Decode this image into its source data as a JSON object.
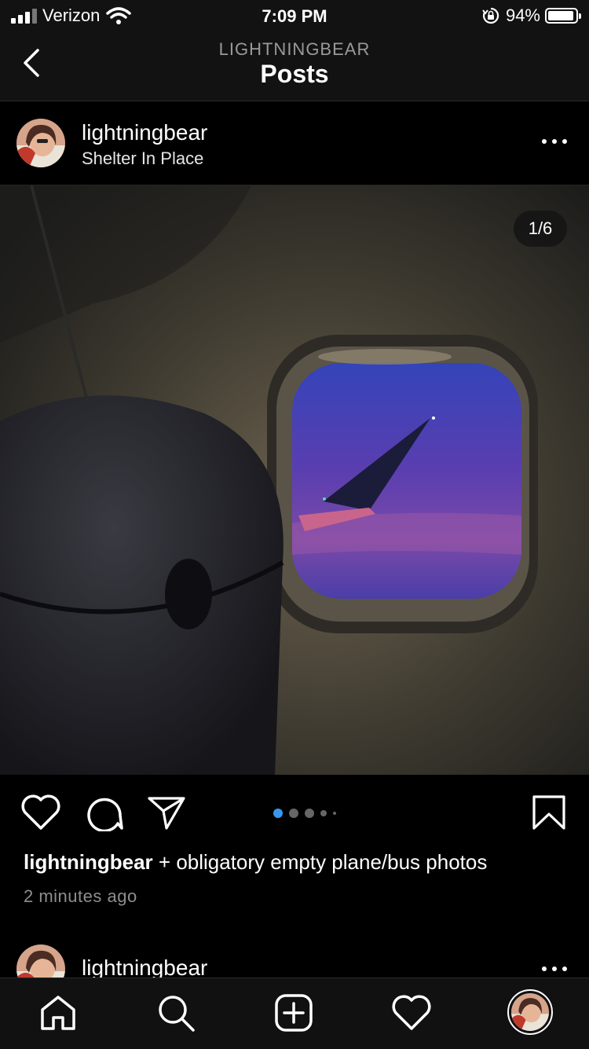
{
  "status_bar": {
    "carrier": "Verizon",
    "time": "7:09 PM",
    "battery_percent": "94%",
    "battery_level": 0.94,
    "icons": [
      "signal-icon",
      "wifi-icon",
      "orientation-lock-icon",
      "battery-icon"
    ]
  },
  "nav": {
    "subtitle": "LIGHTNINGBEAR",
    "title": "Posts"
  },
  "post": {
    "username": "lightningbear",
    "location": "Shelter In Place",
    "image_counter": "1/6",
    "carousel_total": 6,
    "carousel_current": 1,
    "caption_user": "lightningbear",
    "caption_text": "+ obligatory empty plane/bus photos",
    "time_ago": "2 minutes ago",
    "accent_color": "#3897f0"
  },
  "next_post": {
    "username": "lightningbear"
  },
  "tab_bar": {
    "items": [
      "home-icon",
      "search-icon",
      "create-post-icon",
      "activity-heart-icon",
      "profile-avatar"
    ]
  }
}
